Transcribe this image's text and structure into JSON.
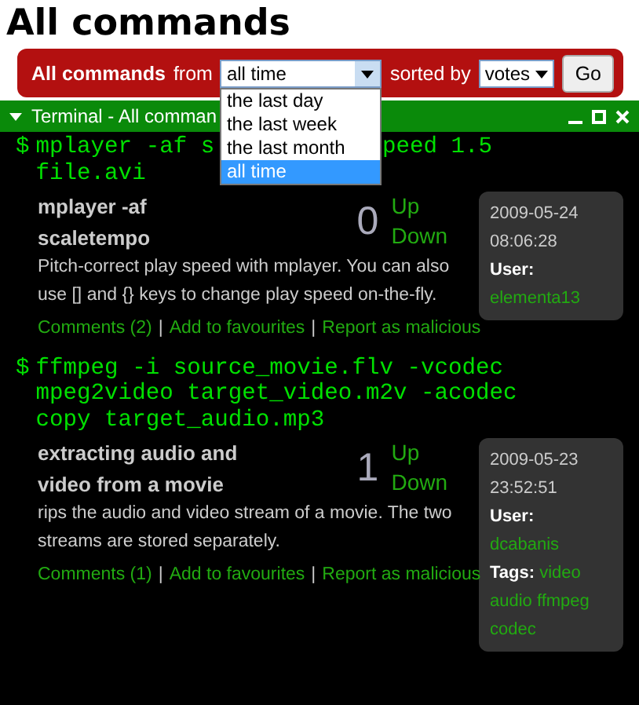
{
  "page_title": "All commands",
  "filter_bar": {
    "from_label": "All commands",
    "from_word": "from",
    "period_value": "all time",
    "sorted_label": "sorted by",
    "sort_value": "votes",
    "go_button": "Go",
    "period_options": [
      {
        "label": "the last day",
        "selected": false
      },
      {
        "label": "the last week",
        "selected": false
      },
      {
        "label": "the last month",
        "selected": false
      },
      {
        "label": "all time",
        "selected": true
      }
    ]
  },
  "terminal": {
    "title": "Terminal - All comman",
    "entries": [
      {
        "prompt": "$",
        "command_lines": [
          [
            "mplayer -af s",
            "peed 1.5"
          ],
          [
            "file.avi"
          ]
        ],
        "summary": "mplayer -af scaletempo",
        "votes": "0",
        "up": "Up",
        "down": "Down",
        "description": "Pitch-correct play speed with mplayer. You can also use [] and {} keys to change play speed on-the-fly.",
        "links": [
          "Comments (2)",
          "Add to favourites",
          "Report as malicious"
        ],
        "separators": [
          "|",
          "|"
        ],
        "date": "2009-05-24",
        "time": "08:06:28",
        "user_label": "User:",
        "user": "elementa13"
      },
      {
        "prompt": "$",
        "command_lines": [
          [
            "ffmpeg -i source_movie.flv -vcodec mpeg2video target_video.m2v -acodec copy target_audio.mp3"
          ]
        ],
        "summary": "extracting audio and video from a movie",
        "votes": "1",
        "up": "Up",
        "down": "Down",
        "description": "rips the audio and video stream of a movie. The two streams are stored separately.",
        "links": [
          "Comments (1)",
          "Add to favourites",
          "Report as malicious"
        ],
        "separators": [
          "|",
          "|"
        ],
        "date": "2009-05-23",
        "time": "23:52:51",
        "user_label": "User:",
        "user": "dcabanis",
        "tags_label": "Tags:",
        "tags": [
          "video",
          "audio",
          "ffmpeg",
          "codec"
        ]
      }
    ]
  }
}
